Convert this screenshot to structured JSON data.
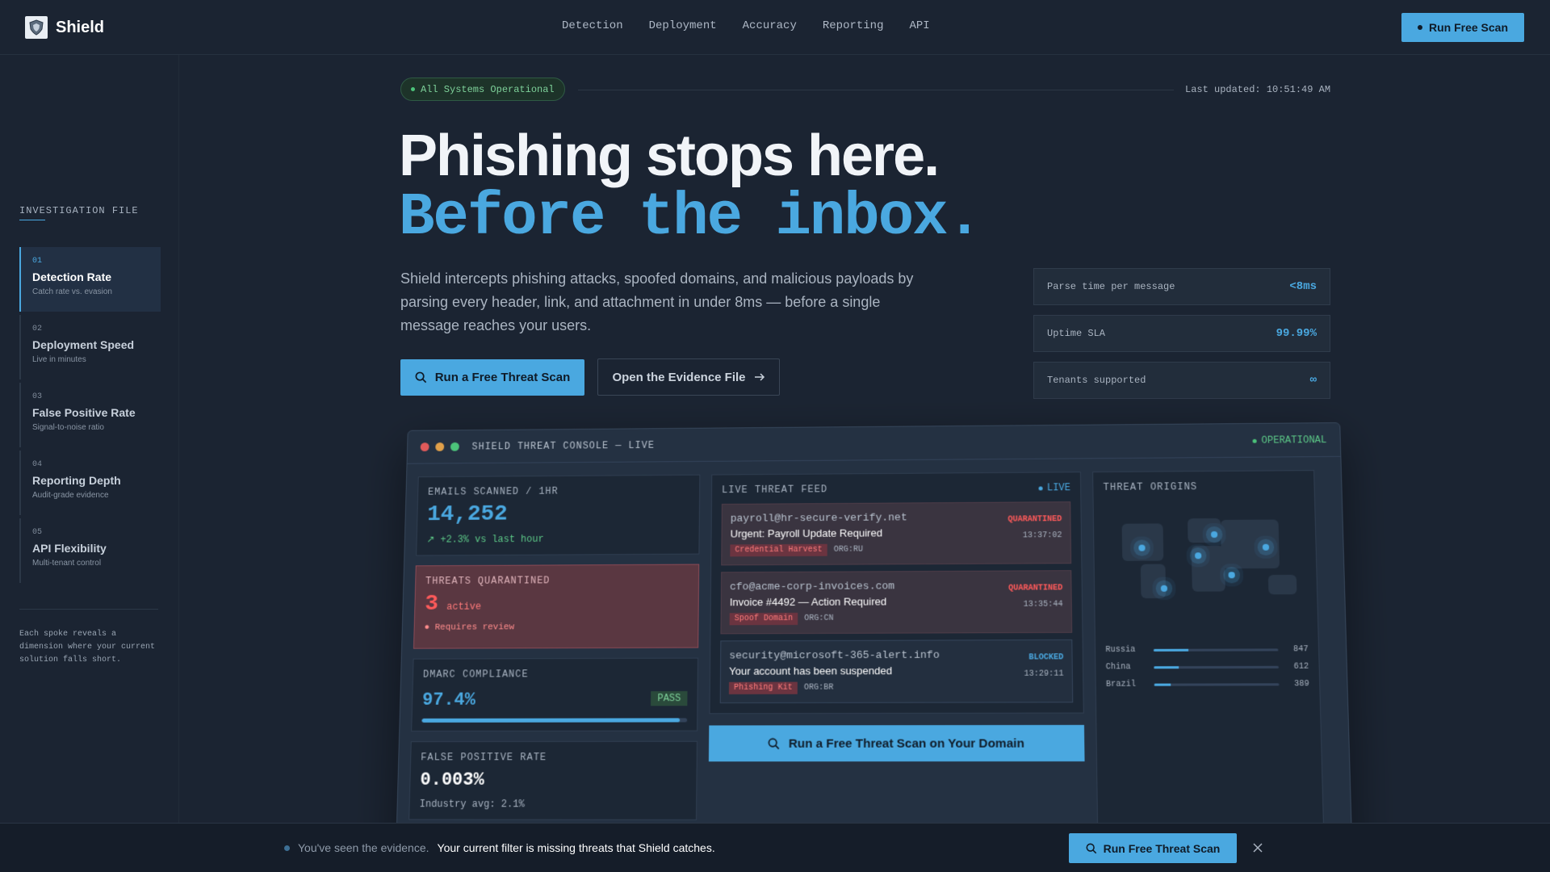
{
  "nav": {
    "brand": "Shield",
    "links": [
      "Detection",
      "Deployment",
      "Accuracy",
      "Reporting",
      "API"
    ],
    "cta": "Run Free Scan"
  },
  "sidebar": {
    "title": "INVESTIGATION FILE",
    "items": [
      {
        "num": "01",
        "name": "Detection Rate",
        "sub": "Catch rate vs. evasion"
      },
      {
        "num": "02",
        "name": "Deployment Speed",
        "sub": "Live in minutes"
      },
      {
        "num": "03",
        "name": "False Positive Rate",
        "sub": "Signal-to-noise ratio"
      },
      {
        "num": "04",
        "name": "Reporting Depth",
        "sub": "Audit-grade evidence"
      },
      {
        "num": "05",
        "name": "API Flexibility",
        "sub": "Multi-tenant control"
      }
    ],
    "note": "Each spoke reveals a dimension where your current solution falls short."
  },
  "status": {
    "pill": "All Systems Operational",
    "updated": "Last updated: 10:51:49 AM"
  },
  "hero": {
    "headline": "Phishing stops here.",
    "headline_mono": "Before the inbox.",
    "lead": "Shield intercepts phishing attacks, spoofed domains, and malicious payloads by parsing every header, link, and attachment in under 8ms — before a single message reaches your users.",
    "primary_cta": "Run a Free Threat Scan",
    "secondary_cta": "Open the Evidence File"
  },
  "metrics": [
    {
      "label": "Parse time per message",
      "value": "<8ms"
    },
    {
      "label": "Uptime SLA",
      "value": "99.99%"
    },
    {
      "label": "Tenants supported",
      "value": "∞"
    }
  ],
  "console": {
    "title": "SHIELD THREAT CONSOLE — LIVE",
    "status": "OPERATIONAL",
    "emails": {
      "label": "EMAILS SCANNED / 1HR",
      "value": "14,252",
      "delta": "+2.3% vs last hour"
    },
    "threats": {
      "label": "THREATS QUARANTINED",
      "value": "3",
      "unit": "active",
      "note": "Requires review"
    },
    "dmarc": {
      "label": "DMARC COMPLIANCE",
      "value": "97.4%",
      "badge": "PASS",
      "fill_percent": 97.4
    },
    "fpr": {
      "label": "FALSE POSITIVE RATE",
      "value": "0.003%",
      "sub": "Industry avg: 2.1%"
    },
    "feed": {
      "title": "LIVE THREAT FEED",
      "live": "LIVE",
      "items": [
        {
          "from": "payroll@hr-secure-verify.net",
          "subject": "Urgent: Payroll Update Required",
          "tag": "Credential Harvest",
          "org": "ORG:RU",
          "status": "QUARANTINED",
          "time": "13:37:02"
        },
        {
          "from": "cfo@acme-corp-invoices.com",
          "subject": "Invoice #4492 — Action Required",
          "tag": "Spoof Domain",
          "org": "ORG:CN",
          "status": "QUARANTINED",
          "time": "13:35:44"
        },
        {
          "from": "security@microsoft-365-alert.info",
          "subject": "Your account has been suspended",
          "tag": "Phishing Kit",
          "org": "ORG:BR",
          "status": "BLOCKED",
          "time": "13:29:11"
        }
      ],
      "scan_cta": "Run a Free Threat Scan on Your Domain"
    },
    "origins": {
      "title": "THREAT ORIGINS",
      "rows": [
        {
          "name": "Russia",
          "count": "847",
          "fraction": 0.28
        },
        {
          "name": "China",
          "count": "612",
          "fraction": 0.2
        },
        {
          "name": "Brazil",
          "count": "389",
          "fraction": 0.13
        }
      ]
    }
  },
  "banner": {
    "muted": "You've seen the evidence.",
    "strong": "Your current filter is missing threats that Shield catches.",
    "cta": "Run Free Threat Scan"
  },
  "colors": {
    "accent": "#4aa8e0",
    "background": "#1b2432",
    "success": "#4cc37a",
    "danger": "#ff5a5a"
  },
  "icons": {
    "logo": "shield-icon",
    "search": "search-icon",
    "arrow": "arrow-right-icon",
    "close": "close-icon",
    "trend": "trend-up-icon"
  }
}
